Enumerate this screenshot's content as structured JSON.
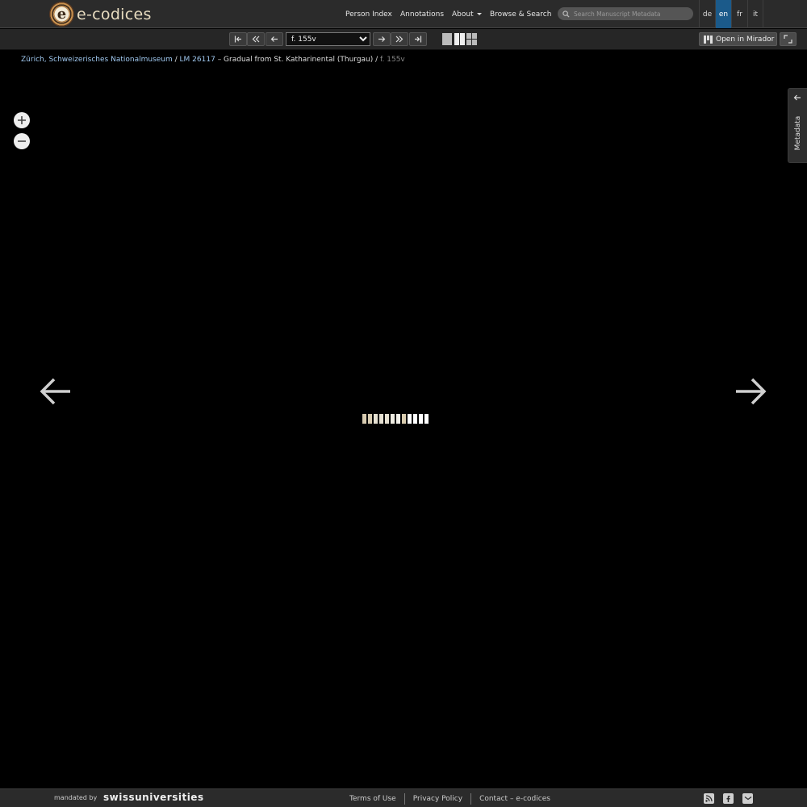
{
  "header": {
    "logo_letter": "e",
    "logo_text": "e-codices",
    "nav": {
      "person_index": "Person Index",
      "annotations": "Annotations",
      "about": "About",
      "browse_search": "Browse & Search"
    },
    "search_placeholder": "Search Manuscript Metadata",
    "languages": [
      "de",
      "en",
      "fr",
      "it"
    ],
    "active_language": "en"
  },
  "toolbar": {
    "first_icon": "first-page-icon",
    "prev_chunk_icon": "double-left-icon",
    "prev_icon": "left-arrow-icon",
    "page_select_value": "f. 155v",
    "next_icon": "right-arrow-icon",
    "next_chunk_icon": "double-right-icon",
    "last_icon": "last-page-icon",
    "open_mirador_label": "Open in Mirador"
  },
  "breadcrumb": {
    "library": "Zürich, Schweizerisches Nationalmuseum",
    "sep1": " / ",
    "shelfmark": "LM 26117",
    "title": " – Gradual from St. Katharinental (Thurgau) / ",
    "folio": "f. 155v"
  },
  "sidebar": {
    "metadata_label": "Metadata"
  },
  "loader": {
    "colors": [
      "#d7cbb0",
      "#d7cbb0",
      "#e6e1d2",
      "#e6e1d2",
      "#e6e1d2",
      "#efece2",
      "#f3f1ea",
      "#d9ccaf",
      "#ffffff",
      "#ffffff",
      "#ffffff",
      "#ffffff"
    ]
  },
  "footer": {
    "mandated_by": "mandated by",
    "sponsor": "swissuniversities",
    "links": {
      "terms": "Terms of Use",
      "privacy": "Privacy Policy",
      "contact": "Contact – e-codices"
    },
    "icons": [
      "rss-icon",
      "facebook-icon",
      "mail-icon"
    ]
  }
}
